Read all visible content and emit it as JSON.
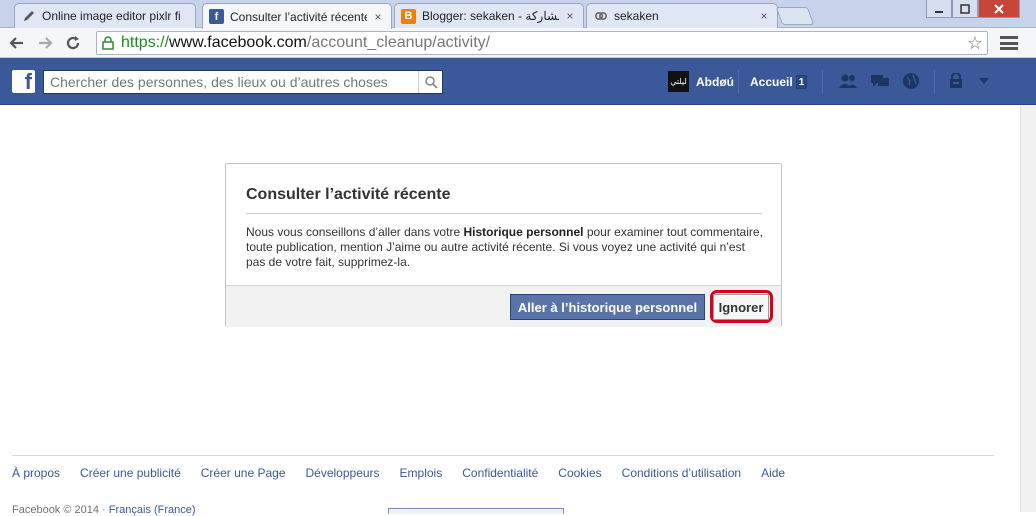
{
  "browser": {
    "tabs": [
      {
        "title": "Online image editor pixlr fi",
        "icon": "pencil-icon"
      },
      {
        "title": "Consulter l’activité récente",
        "icon": "facebook-icon"
      },
      {
        "title": "Blogger: sekaken - مشاركة",
        "icon": "blogger-icon"
      },
      {
        "title": "sekaken",
        "icon": "link-icon"
      }
    ],
    "close_glyph": "×",
    "url": {
      "scheme": "https://",
      "host": "www.facebook.com",
      "path": "/account_cleanup/activity/"
    }
  },
  "facebook": {
    "logo": "f",
    "search_placeholder": "Chercher des personnes, des lieux ou d’autres choses",
    "profile_name": "Abdøú",
    "avatar_text": "ليلتي",
    "home_label": "Accueil",
    "home_badge": "1"
  },
  "dialog": {
    "title": "Consulter l’activité récente",
    "body_before": "Nous vous conseillons d’aller dans votre ",
    "body_bold": "Historique personnel",
    "body_after": " pour examiner tout commentaire, toute publication, mention J’aime ou autre activité récente. Si vous voyez une activité qui n’est pas de votre fait, supprimez-la.",
    "primary_button": "Aller à l’historique personnel",
    "ignore_button": "Ignorer"
  },
  "footer": {
    "links": [
      "À propos",
      "Créer une publicité",
      "Créer une Page",
      "Développeurs",
      "Emplois",
      "Confidentialité",
      "Cookies",
      "Conditions d’utilisation",
      "Aide"
    ],
    "copyright": "Facebook © 2014 · ",
    "language": "Français (France)"
  },
  "colors": {
    "facebook_blue": "#3b5998",
    "highlight_red": "#d8001c"
  }
}
